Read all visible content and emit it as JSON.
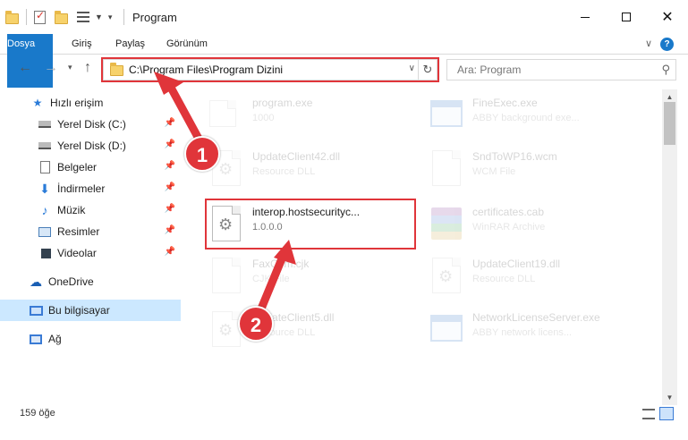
{
  "window": {
    "title": "Program"
  },
  "ribbon": {
    "tabs": [
      "Dosya",
      "Giriş",
      "Paylaş",
      "Görünüm"
    ],
    "help": "?"
  },
  "address": {
    "path": "C:\\Program Files\\Program Dizini"
  },
  "search": {
    "placeholder": "Ara: Program"
  },
  "sidebar": {
    "items": [
      {
        "label": "Hızlı erişim"
      },
      {
        "label": "Yerel Disk (C:)"
      },
      {
        "label": "Yerel Disk (D:)"
      },
      {
        "label": "Belgeler"
      },
      {
        "label": "İndirmeler"
      },
      {
        "label": "Müzik"
      },
      {
        "label": "Resimler"
      },
      {
        "label": "Videolar"
      },
      {
        "label": "OneDrive"
      },
      {
        "label": "Bu bilgisayar"
      },
      {
        "label": "Ağ"
      }
    ]
  },
  "files": [
    {
      "name": "program.exe",
      "sub": "1000"
    },
    {
      "name": "FineExec.exe",
      "sub": "ABBY background exe..."
    },
    {
      "name": "UpdateClient42.dll",
      "sub": "Resource DLL"
    },
    {
      "name": "SndToWP16.wcm",
      "sub": "WCM File"
    },
    {
      "name": "interop.hostsecurityc...",
      "sub": "1.0.0.0"
    },
    {
      "name": "certificates.cab",
      "sub": "WinRAR Archive"
    },
    {
      "name": "FaxCom.cjk",
      "sub": "CJK File"
    },
    {
      "name": "UpdateClient19.dll",
      "sub": "Resource DLL"
    },
    {
      "name": "UpdateClient5.dll",
      "sub": "Resource DLL"
    },
    {
      "name": "NetworkLicenseServer.exe",
      "sub": "ABBY network licens..."
    }
  ],
  "status": {
    "count": "159 öğe"
  },
  "annotations": {
    "step1": "1",
    "step2": "2",
    "color": "#e0353a"
  }
}
